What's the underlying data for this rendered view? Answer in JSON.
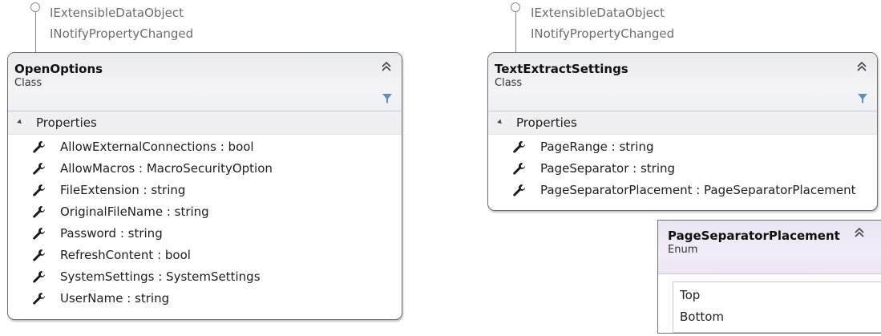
{
  "interfaces_left": [
    "IExtensibleDataObject",
    "INotifyPropertyChanged"
  ],
  "interfaces_right": [
    "IExtensibleDataObject",
    "INotifyPropertyChanged"
  ],
  "open_options": {
    "title": "OpenOptions",
    "kind": "Class",
    "section": "Properties",
    "members": [
      "AllowExternalConnections : bool",
      "AllowMacros : MacroSecurityOption",
      "FileExtension : string",
      "OriginalFileName : string",
      "Password : string",
      "RefreshContent : bool",
      "SystemSettings : SystemSettings",
      "UserName : string"
    ]
  },
  "text_extract_settings": {
    "title": "TextExtractSettings",
    "kind": "Class",
    "section": "Properties",
    "members": [
      "PageRange : string",
      "PageSeparator : string",
      "PageSeparatorPlacement : PageSeparatorPlacement"
    ]
  },
  "page_separator_placement": {
    "title": "PageSeparatorPlacement",
    "kind": "Enum",
    "values": [
      "Top",
      "Bottom"
    ]
  }
}
